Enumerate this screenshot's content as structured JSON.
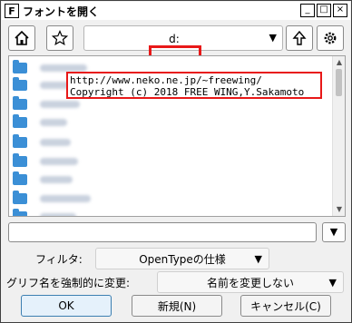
{
  "window": {
    "title": "フォントを開く",
    "buttons": [
      "_",
      "□",
      "×"
    ]
  },
  "toolbar": {
    "home_icon": "home-icon",
    "favorite_icon": "star-icon",
    "drive_value": "d:",
    "up_icon": "up-arrow-icon",
    "settings_icon": "gear-icon"
  },
  "credit": {
    "line1": "http://www.neko.ne.jp/~freewing/",
    "line2": "Copyright (c) 2018 FREE WING,Y.Sakamoto"
  },
  "filter": {
    "label": "フィルタ:",
    "value": "OpenTypeの仕様"
  },
  "rename": {
    "label": "グリフ名を強制的に変更:",
    "value": "名前を変更しない"
  },
  "buttons": {
    "ok": "OK",
    "new": "新規(N)",
    "cancel": "キャンセル(C)"
  },
  "colors": {
    "highlight": "#e81818",
    "folder": "#3b8fd6"
  }
}
